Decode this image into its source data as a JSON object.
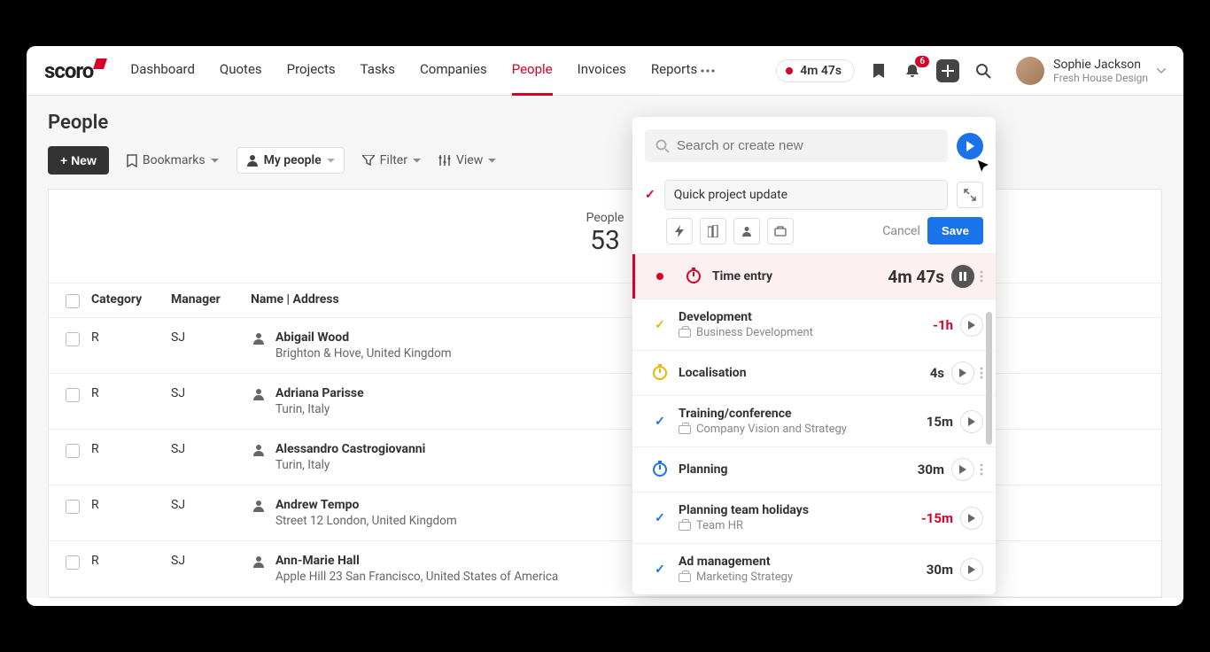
{
  "brand": "scoro",
  "nav": {
    "items": [
      "Dashboard",
      "Quotes",
      "Projects",
      "Tasks",
      "Companies",
      "People",
      "Invoices",
      "Reports"
    ],
    "active_index": 5
  },
  "header": {
    "timer": "4m 47s",
    "notification_count": "6"
  },
  "user": {
    "name": "Sophie Jackson",
    "org": "Fresh House Design"
  },
  "page": {
    "title": "People",
    "new_button": "+  New",
    "bookmarks": "Bookmarks",
    "my_people": "My people",
    "filter": "Filter",
    "view": "View"
  },
  "summary": {
    "label": "People",
    "count": "53"
  },
  "columns": {
    "category": "Category",
    "manager": "Manager",
    "name": "Name | Address"
  },
  "rows": [
    {
      "cat": "R",
      "mgr": "SJ",
      "name": "Abigail Wood",
      "addr": "Brighton & Hove, United Kingdom"
    },
    {
      "cat": "R",
      "mgr": "SJ",
      "name": "Adriana Parisse",
      "addr": "Turin, Italy"
    },
    {
      "cat": "R",
      "mgr": "SJ",
      "name": "Alessandro Castrogiovanni",
      "addr": "Turin, Italy"
    },
    {
      "cat": "R",
      "mgr": "SJ",
      "name": "Andrew Tempo",
      "addr": "Street 12 London, United Kingdom"
    },
    {
      "cat": "R",
      "mgr": "SJ",
      "name": "Ann-Marie Hall",
      "addr": "Apple Hill 23 San Francisco, United States of America"
    }
  ],
  "panel": {
    "search_placeholder": "Search or create new",
    "quick_title": "Quick project update",
    "cancel": "Cancel",
    "save": "Save",
    "entries": [
      {
        "mark": "record",
        "icon": "stopwatch-red",
        "title": "Time entry",
        "sub": "",
        "time": "4m 47s",
        "time_style": "big",
        "btn": "pause",
        "kebab": true
      },
      {
        "mark": "check-yellow",
        "icon": "",
        "title": "Development",
        "sub": "Business Development",
        "sub_icon": "briefcase",
        "time": "-1h",
        "time_style": "neg",
        "btn": "play",
        "kebab": false
      },
      {
        "mark": "",
        "icon": "stopwatch-yellow",
        "title": "Localisation",
        "sub": "",
        "time": "4s",
        "time_style": "",
        "btn": "play",
        "kebab": true
      },
      {
        "mark": "check-blue",
        "icon": "",
        "title": "Training/conference",
        "sub": "Company Vision and Strategy",
        "sub_icon": "briefcase",
        "time": "15m",
        "time_style": "",
        "btn": "play",
        "kebab": false
      },
      {
        "mark": "",
        "icon": "stopwatch-blue",
        "title": "Planning",
        "sub": "",
        "time": "30m",
        "time_style": "",
        "btn": "play",
        "kebab": true
      },
      {
        "mark": "check-blue",
        "icon": "",
        "title": "Planning team holidays",
        "sub": "Team HR",
        "sub_icon": "briefcase",
        "time": "-15m",
        "time_style": "neg",
        "btn": "play",
        "kebab": false
      },
      {
        "mark": "check-blue",
        "icon": "",
        "title": "Ad management",
        "sub": "Marketing Strategy",
        "sub_icon": "briefcase",
        "time": "30m",
        "time_style": "",
        "btn": "play",
        "kebab": false
      }
    ]
  }
}
